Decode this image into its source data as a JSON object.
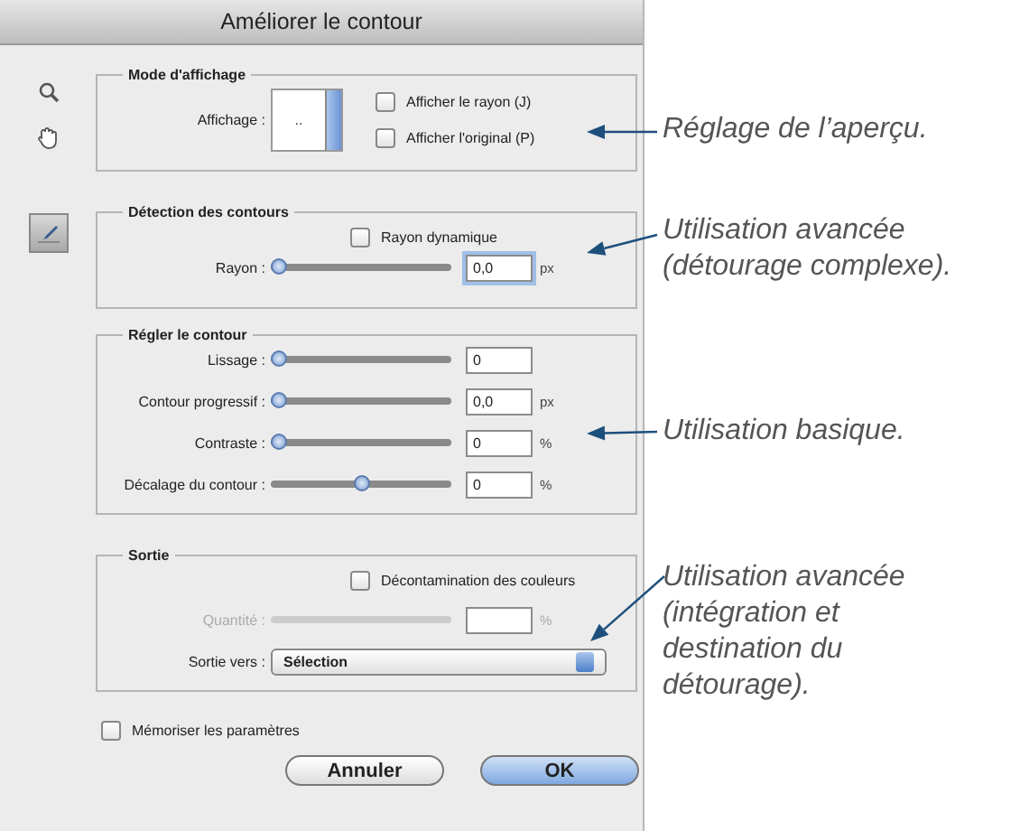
{
  "window": {
    "title": "Améliorer le contour"
  },
  "tools": [
    {
      "kind": "zoom",
      "selected": false
    },
    {
      "kind": "hand",
      "selected": false
    },
    {
      "kind": "brush",
      "selected": true
    }
  ],
  "sections": [
    {
      "title": "Mode d'affichage",
      "rows": [
        {
          "kind": "view",
          "label": "Affichage :",
          "preview": "..",
          "checkboxes": [
            {
              "label": "Afficher le rayon (J)",
              "checked": false
            },
            {
              "label": "Afficher l'original (P)",
              "checked": false
            }
          ]
        }
      ]
    },
    {
      "title": "Détection des contours",
      "rows": [
        {
          "kind": "checkbox",
          "label": "Rayon dynamique",
          "checked": false
        },
        {
          "kind": "slider",
          "label": "Rayon :",
          "level": 0,
          "value": "0,0",
          "unit": "px",
          "disabled": false,
          "focused": true
        }
      ]
    },
    {
      "title": "Régler le contour",
      "rows": [
        {
          "kind": "slider",
          "label": "Lissage :",
          "level": 0,
          "value": "0",
          "disabled": false,
          "focused": false
        },
        {
          "kind": "slider",
          "label": "Contour progressif :",
          "level": 0,
          "value": "0,0",
          "unit": "px",
          "disabled": false,
          "focused": false
        },
        {
          "kind": "slider",
          "label": "Contraste :",
          "level": 0,
          "value": "0",
          "unit": "%",
          "disabled": false,
          "focused": false
        },
        {
          "kind": "slider",
          "label": "Décalage du contour :",
          "level": 0.5,
          "value": "0",
          "unit": "%",
          "disabled": false,
          "focused": false
        }
      ]
    },
    {
      "title": "Sortie",
      "rows": [
        {
          "kind": "checkbox",
          "label": "Décontamination des couleurs",
          "checked": false
        },
        {
          "kind": "slider",
          "label": "Quantité :",
          "unit": "%",
          "disabled": true,
          "focused": false
        },
        {
          "kind": "select",
          "label": "Sortie vers :",
          "value": "Sélection"
        }
      ]
    }
  ],
  "remember": {
    "label": "Mémoriser les paramètres",
    "checked": false
  },
  "buttons": [
    {
      "label": "Annuler",
      "default": false
    },
    {
      "label": "OK",
      "default": true
    }
  ],
  "annotations": [
    {
      "lines": [
        "Réglage de l’aperçu."
      ]
    },
    {
      "lines": [
        "Utilisation avancée",
        "(détourage complexe)."
      ]
    },
    {
      "lines": [
        "Utilisation basique."
      ]
    },
    {
      "lines": [
        "Utilisation avancée",
        "(intégration et",
        "destination du",
        "détourage)."
      ]
    }
  ]
}
